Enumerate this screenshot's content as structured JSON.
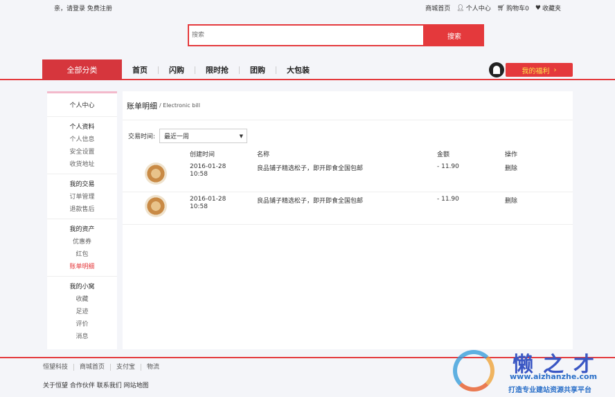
{
  "topbar": {
    "greeting": "亲，请登录 免费注册",
    "links": [
      {
        "icon": "",
        "label": "商城首页"
      },
      {
        "icon": "user-icon",
        "label": "个人中心"
      },
      {
        "icon": "cart-icon",
        "label": "购物车0"
      },
      {
        "icon": "heart-icon",
        "label": "收藏夹"
      }
    ]
  },
  "search": {
    "placeholder": "搜索",
    "button": "搜索"
  },
  "nav": {
    "category": "全部分类",
    "links": [
      "首页",
      "闪购",
      "限时抢",
      "团购",
      "大包装"
    ],
    "welfare": "我的福利",
    "welfare_arrow": "›"
  },
  "sidebar": {
    "home": "个人中心",
    "groups": [
      {
        "title": "个人资料",
        "items": [
          "个人信息",
          "安全设置",
          "收货地址"
        ]
      },
      {
        "title": "我的交易",
        "items": [
          "订单管理",
          "退款售后"
        ]
      },
      {
        "title": "我的资产",
        "items": [
          "优惠券",
          "红包",
          "账单明细"
        ]
      },
      {
        "title": "我的小窝",
        "items": [
          "收藏",
          "足迹",
          "评价",
          "消息"
        ]
      }
    ],
    "active_item": "账单明细"
  },
  "main": {
    "title": "账单明细",
    "subtitle": "/ Electronic bill",
    "filter_label": "交易时间:",
    "filter_value": "最近一周",
    "columns": {
      "time": "创建时间",
      "name": "名称",
      "amount": "金额",
      "op": "操作"
    },
    "rows": [
      {
        "date": "2016-01-28",
        "time": "10:58",
        "name": "良品铺子精选松子，即开即食全国包邮",
        "amount": "- 11.90",
        "op": "删除"
      },
      {
        "date": "2016-01-28",
        "time": "10:58",
        "name": "良品铺子精选松子，即开即食全国包邮",
        "amount": "- 11.90",
        "op": "删除"
      }
    ]
  },
  "footer": {
    "links": [
      "恒望科技",
      "商城首页",
      "支付宝",
      "物流"
    ],
    "about": "关于恒望 合作伙伴 联系我们 网站地图"
  },
  "watermark": {
    "cn": "懒之才",
    "url": "www.aizhanzhe.com",
    "slogan": "打造专业建站资源共享平台"
  },
  "colors": {
    "accent": "#e4393c",
    "welfare_text": "#fde34b",
    "sidebar_top": "#f3b9cb"
  }
}
